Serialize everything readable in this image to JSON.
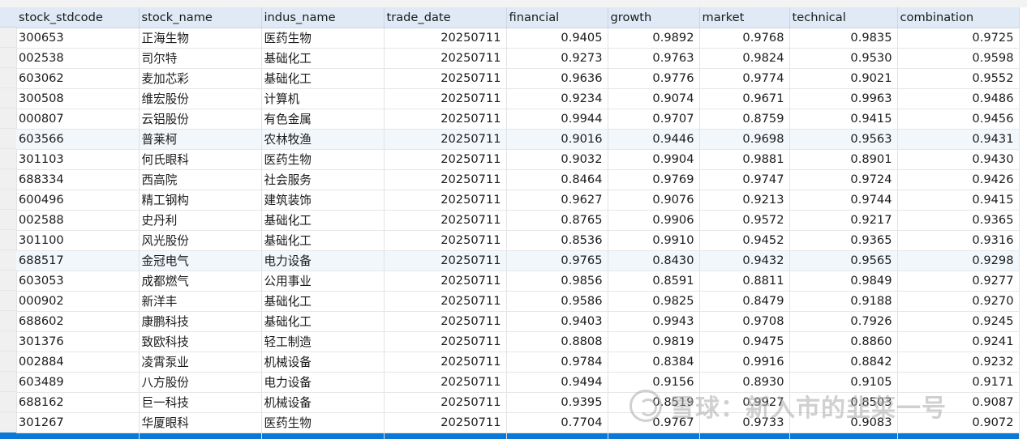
{
  "table": {
    "columns": [
      "stock_stdcode",
      "stock_name",
      "indus_name",
      "trade_date",
      "financial",
      "growth",
      "market",
      "technical",
      "combination"
    ],
    "rows": [
      [
        "300653",
        "正海生物",
        "医药生物",
        "20250711",
        "0.9405",
        "0.9892",
        "0.9768",
        "0.9835",
        "0.9725"
      ],
      [
        "002538",
        "司尔特",
        "基础化工",
        "20250711",
        "0.9273",
        "0.9763",
        "0.9824",
        "0.9530",
        "0.9598"
      ],
      [
        "603062",
        "麦加芯彩",
        "基础化工",
        "20250711",
        "0.9636",
        "0.9776",
        "0.9774",
        "0.9021",
        "0.9552"
      ],
      [
        "300508",
        "维宏股份",
        "计算机",
        "20250711",
        "0.9234",
        "0.9074",
        "0.9671",
        "0.9963",
        "0.9486"
      ],
      [
        "000807",
        "云铝股份",
        "有色金属",
        "20250711",
        "0.9944",
        "0.9707",
        "0.8759",
        "0.9415",
        "0.9456"
      ],
      [
        "603566",
        "普莱柯",
        "农林牧渔",
        "20250711",
        "0.9016",
        "0.9446",
        "0.9698",
        "0.9563",
        "0.9431"
      ],
      [
        "301103",
        "何氏眼科",
        "医药生物",
        "20250711",
        "0.9032",
        "0.9904",
        "0.9881",
        "0.8901",
        "0.9430"
      ],
      [
        "688334",
        "西高院",
        "社会服务",
        "20250711",
        "0.8464",
        "0.9769",
        "0.9747",
        "0.9724",
        "0.9426"
      ],
      [
        "600496",
        "精工钢构",
        "建筑装饰",
        "20250711",
        "0.9627",
        "0.9076",
        "0.9213",
        "0.9744",
        "0.9415"
      ],
      [
        "002588",
        "史丹利",
        "基础化工",
        "20250711",
        "0.8765",
        "0.9906",
        "0.9572",
        "0.9217",
        "0.9365"
      ],
      [
        "301100",
        "风光股份",
        "基础化工",
        "20250711",
        "0.8536",
        "0.9910",
        "0.9452",
        "0.9365",
        "0.9316"
      ],
      [
        "688517",
        "金冠电气",
        "电力设备",
        "20250711",
        "0.9765",
        "0.8430",
        "0.9432",
        "0.9565",
        "0.9298"
      ],
      [
        "603053",
        "成都燃气",
        "公用事业",
        "20250711",
        "0.9856",
        "0.8591",
        "0.8811",
        "0.9849",
        "0.9277"
      ],
      [
        "000902",
        "新洋丰",
        "基础化工",
        "20250711",
        "0.9586",
        "0.9825",
        "0.8479",
        "0.9188",
        "0.9270"
      ],
      [
        "688602",
        "康鹏科技",
        "基础化工",
        "20250711",
        "0.9403",
        "0.9943",
        "0.9708",
        "0.7926",
        "0.9245"
      ],
      [
        "301376",
        "致欧科技",
        "轻工制造",
        "20250711",
        "0.8808",
        "0.9819",
        "0.9475",
        "0.8860",
        "0.9241"
      ],
      [
        "002884",
        "凌霄泵业",
        "机械设备",
        "20250711",
        "0.9784",
        "0.8384",
        "0.9916",
        "0.8842",
        "0.9232"
      ],
      [
        "603489",
        "八方股份",
        "电力设备",
        "20250711",
        "0.9494",
        "0.9156",
        "0.8930",
        "0.9105",
        "0.9171"
      ],
      [
        "688162",
        "巨一科技",
        "机械设备",
        "20250711",
        "0.9395",
        "0.8519",
        "0.9927",
        "0.8503",
        "0.9087"
      ],
      [
        "301267",
        "华厦眼科",
        "医药生物",
        "20250711",
        "0.7704",
        "0.9767",
        "0.9733",
        "0.9083",
        "0.9072"
      ]
    ]
  },
  "watermark_text": "雪球：新入市的韭菜一号",
  "colors": {
    "header_bg": "#dfeaf6",
    "alt_row_bg": "#f2f7fc",
    "selection": "#0a78d7"
  }
}
